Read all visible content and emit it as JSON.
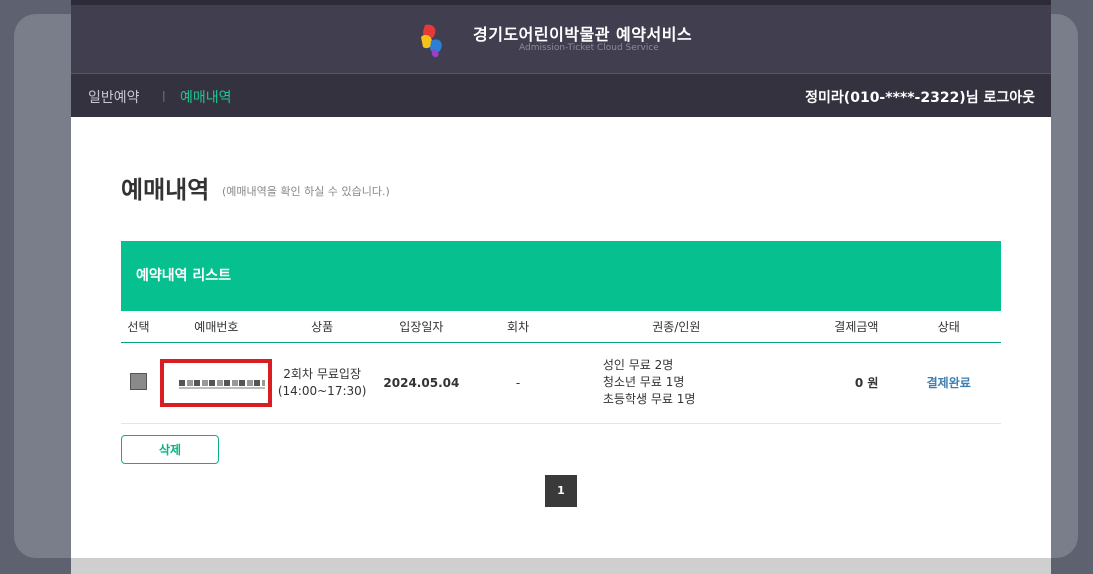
{
  "header": {
    "title": "경기도어린이박물관 예약서비스",
    "subtitle": "Admission-Ticket Cloud Service",
    "logo_icon": "museum-logo-icon"
  },
  "nav": {
    "general_label": "일반예약",
    "separator": "|",
    "history_label": "예매내역",
    "user_label": "정미라(010-****-2322)님",
    "logout_label": "로그아웃"
  },
  "main": {
    "heading": "예매내역",
    "heading_note": "(예매내역을 확인 하실 수 있습니다.)",
    "list_title": "예약내역 리스트",
    "columns": [
      "선택",
      "예매번호",
      "상품",
      "입장일자",
      "회차",
      "권종/인원",
      "결제금액",
      "상태"
    ],
    "rows": [
      {
        "product_line1": "2회차 무료입장",
        "product_line2": "(14:00~17:30)",
        "date": "2024.05.04",
        "round": "-",
        "people": [
          "성인 무료 2명",
          "청소년 무료 1명",
          "초등학생 무료 1명"
        ],
        "amount": "0 원",
        "status": "결제완료"
      }
    ],
    "delete_label": "삭제",
    "current_page": "1"
  },
  "colors": {
    "accent": "#07c08f",
    "header_bg": "#413e50",
    "nav_bg": "#34323f",
    "highlight_border": "#d81e20",
    "status_text": "#3e7fb2"
  }
}
